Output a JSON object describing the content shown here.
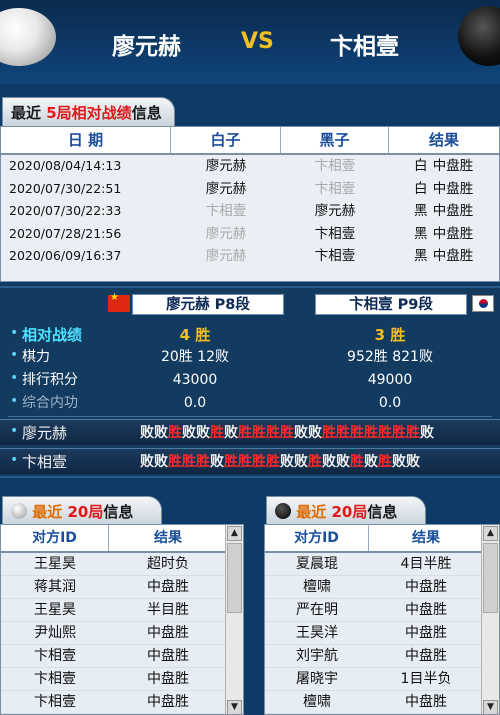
{
  "header": {
    "player_white": "廖元赫",
    "vs": "VS",
    "player_black": "卞相壹"
  },
  "recent5": {
    "title_prefix": "最近 ",
    "title_count": "5局",
    "title_mid": "相对战绩",
    "title_suffix": "信息",
    "columns": [
      "日 期",
      "白子",
      "黑子",
      "结果"
    ],
    "rows": [
      {
        "date": "2020/08/04/14:13",
        "white": "廖元赫",
        "black": "卞相壹",
        "side": "白",
        "result": "中盘胜",
        "white_gray": false,
        "black_gray": true
      },
      {
        "date": "2020/07/30/22:51",
        "white": "廖元赫",
        "black": "卞相壹",
        "side": "白",
        "result": "中盘胜",
        "white_gray": false,
        "black_gray": true
      },
      {
        "date": "2020/07/30/22:33",
        "white": "卞相壹",
        "black": "廖元赫",
        "side": "黑",
        "result": "中盘胜",
        "white_gray": true,
        "black_gray": false
      },
      {
        "date": "2020/07/28/21:56",
        "white": "廖元赫",
        "black": "卞相壹",
        "side": "黑",
        "result": "中盘胜",
        "white_gray": true,
        "black_gray": false
      },
      {
        "date": "2020/06/09/16:37",
        "white": "廖元赫",
        "black": "卞相壹",
        "side": "黑",
        "result": "中盘胜",
        "white_gray": true,
        "black_gray": false
      }
    ]
  },
  "stats": {
    "p1_label": "廖元赫  P8段",
    "p2_label": "卞相壹  P9段",
    "rows": [
      {
        "label": "相对战绩",
        "v1": "4  胜",
        "v2": "3  胜"
      },
      {
        "label": "棋力",
        "v1": "20胜  12败",
        "v2": "952胜  821败"
      },
      {
        "label": "排行积分",
        "v1": "43000",
        "v2": "49000"
      },
      {
        "label": "综合内功",
        "v1": "0.0",
        "v2": "0.0"
      }
    ],
    "results": [
      {
        "name": "廖元赫",
        "seq": "败败胜败败胜败胜胜胜胜败败胜胜胜胜胜胜胜败"
      },
      {
        "name": "卞相壹",
        "seq": "败败胜胜胜败胜胜胜胜败败胜败败胜败胜败败"
      }
    ]
  },
  "recent20_white": {
    "title_prefix": "最近 ",
    "title_count": "20局",
    "title_suffix": "信息",
    "columns": [
      "对方ID",
      "结果"
    ],
    "rows": [
      {
        "opponent": "王星昊",
        "result": "超时负",
        "gray": true
      },
      {
        "opponent": "蒋其润",
        "result": "中盘胜",
        "gray": false
      },
      {
        "opponent": "王星昊",
        "result": "半目胜",
        "gray": false
      },
      {
        "opponent": "尹灿熙",
        "result": "中盘胜",
        "gray": false
      },
      {
        "opponent": "卞相壹",
        "result": "中盘胜",
        "gray": false
      },
      {
        "opponent": "卞相壹",
        "result": "中盘胜",
        "gray": false
      },
      {
        "opponent": "卞相壹",
        "result": "中盘胜",
        "gray": false
      }
    ]
  },
  "recent20_black": {
    "title_prefix": "最近 ",
    "title_count": "20局",
    "title_suffix": "信息",
    "columns": [
      "对方ID",
      "结果"
    ],
    "rows": [
      {
        "opponent": "夏晨琨",
        "result": "4目半胜",
        "gray": false
      },
      {
        "opponent": "檀啸",
        "result": "中盘胜",
        "gray": false
      },
      {
        "opponent": "严在明",
        "result": "中盘胜",
        "gray": false
      },
      {
        "opponent": "王昊洋",
        "result": "中盘胜",
        "gray": false
      },
      {
        "opponent": "刘宇航",
        "result": "中盘胜",
        "gray": false
      },
      {
        "opponent": "屠晓宇",
        "result": "1目半负",
        "gray": true
      },
      {
        "opponent": "檀啸",
        "result": "中盘胜",
        "gray": false
      }
    ]
  },
  "colors": {
    "accent_red": "#e01818",
    "accent_orange": "#e06b00",
    "gold": "#f0c020",
    "cyan": "#4fe0ff"
  }
}
